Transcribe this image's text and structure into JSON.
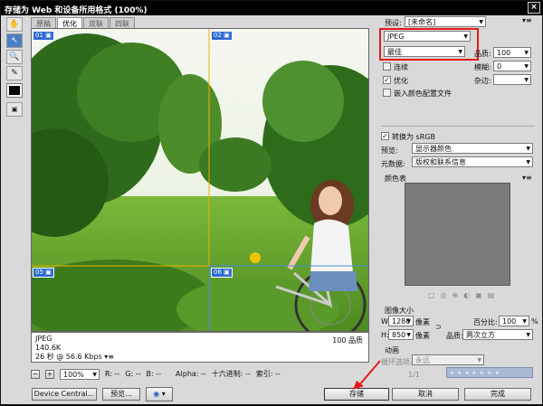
{
  "window": {
    "title": "存储为 Web 和设备所用格式 (100%)",
    "close": "×"
  },
  "tools": [
    {
      "name": "hand-tool",
      "glyph": "✋"
    },
    {
      "name": "slice-select-tool",
      "glyph": "↖"
    },
    {
      "name": "zoom-tool",
      "glyph": "🔍"
    },
    {
      "name": "eyedropper-tool",
      "glyph": "✎"
    }
  ],
  "tabs": [
    "原稿",
    "优化",
    "双联",
    "四联"
  ],
  "slices": [
    "01",
    "02",
    "05",
    "06"
  ],
  "info": {
    "format": "JPEG",
    "size": "140.6K",
    "time": "26 秒 @ 56.6 Kbps",
    "quality": "100 品质"
  },
  "status": {
    "zoom": "100%",
    "r": "R: --",
    "g": "G: --",
    "b": "B: --",
    "alpha": "Alpha: --",
    "hex": "十六进制: --",
    "index": "索引: --"
  },
  "panel": {
    "preset_label": "预设:",
    "preset_value": "[未命名]",
    "format_value": "JPEG",
    "quality_preset": "最佳",
    "quality_label": "品质:",
    "quality_value": "100",
    "progressive_label": "连续",
    "blur_label": "模糊:",
    "blur_value": "0",
    "optimized_label": "优化",
    "matte_label": "杂边:",
    "embed_profile_label": "嵌入颜色配置文件",
    "convert_srgb_label": "转换为 sRGB",
    "preview_label": "预览:",
    "preview_value": "显示器颜色",
    "metadata_label": "元数据:",
    "metadata_value": "版权和联系信息",
    "color_table_label": "颜色表",
    "image_size_label": "图像大小",
    "w_label": "W:",
    "w_value": "1280",
    "h_label": "H:",
    "h_value": "850",
    "unit": "像素",
    "percent_label": "百分比:",
    "percent_value": "100",
    "percent_unit": "%",
    "resample_label": "品质:",
    "resample_value": "两次立方",
    "anim_label": "动画",
    "loop_label": "循环选项:",
    "loop_value": "永远",
    "frame": "1/1"
  },
  "buttons": {
    "device_central": "Device Central...",
    "preview": "预览...",
    "save": "存储",
    "cancel": "取消",
    "done": "完成"
  }
}
